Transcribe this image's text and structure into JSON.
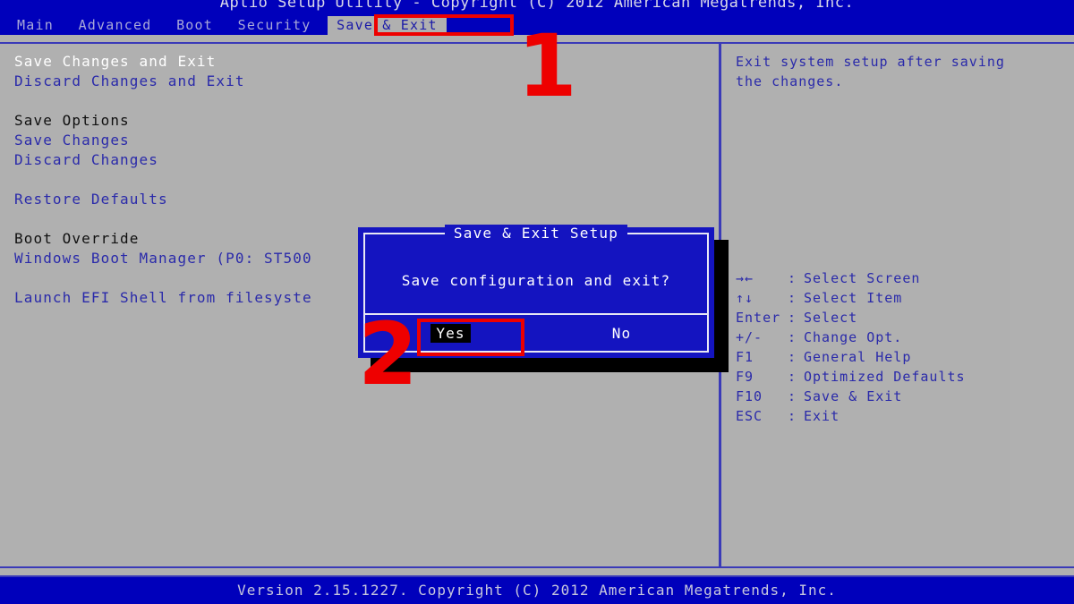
{
  "titlebar": {
    "text": "Aptio Setup Utility - Copyright (C) 2012 American Megatrends, Inc."
  },
  "menubar": {
    "items": [
      {
        "label": "Main",
        "active": false
      },
      {
        "label": "Advanced",
        "active": false
      },
      {
        "label": "Boot",
        "active": false
      },
      {
        "label": "Security",
        "active": false
      },
      {
        "label": "Save & Exit",
        "active": true
      }
    ]
  },
  "left_pane": {
    "rows": [
      {
        "label": "Save Changes and Exit",
        "style": "selected"
      },
      {
        "label": "Discard Changes and Exit",
        "style": "link"
      },
      {
        "label": "",
        "style": "spacer"
      },
      {
        "label": "Save Options",
        "style": "header"
      },
      {
        "label": "Save Changes",
        "style": "link"
      },
      {
        "label": "Discard Changes",
        "style": "link"
      },
      {
        "label": "",
        "style": "spacer"
      },
      {
        "label": "Restore Defaults",
        "style": "link"
      },
      {
        "label": "",
        "style": "spacer"
      },
      {
        "label": "Boot Override",
        "style": "header"
      },
      {
        "label": "Windows Boot Manager (P0: ST500",
        "style": "link"
      },
      {
        "label": "",
        "style": "spacer"
      },
      {
        "label": "Launch EFI Shell from filesyste",
        "style": "link"
      }
    ]
  },
  "right_pane": {
    "help_lines": [
      "Exit system setup after saving",
      "the changes."
    ],
    "legend": [
      {
        "key": "→←",
        "label": "Select Screen"
      },
      {
        "key": "↑↓",
        "label": "Select Item"
      },
      {
        "key": "Enter",
        "label": "Select"
      },
      {
        "key": "+/-",
        "label": "Change Opt."
      },
      {
        "key": "F1",
        "label": "General Help"
      },
      {
        "key": "F9",
        "label": "Optimized Defaults"
      },
      {
        "key": "F10",
        "label": "Save & Exit"
      },
      {
        "key": "ESC",
        "label": "Exit"
      }
    ],
    "legend_separator": ":"
  },
  "dialog": {
    "title": "Save & Exit Setup",
    "message": "Save configuration and exit?",
    "buttons": [
      {
        "label": "Yes",
        "focused": true
      },
      {
        "label": "No",
        "focused": false
      }
    ]
  },
  "annotations": [
    {
      "number": "1"
    },
    {
      "number": "2"
    }
  ],
  "footer": {
    "text": "Version 2.15.1227. Copyright (C) 2012 American Megatrends, Inc."
  },
  "colors": {
    "bios_blue": "#0000bb",
    "dialog_blue": "#1414c0",
    "desktop_gray": "#b0b0b0",
    "link_blue": "#2a2aaa",
    "annotation_red": "#ee0000"
  }
}
